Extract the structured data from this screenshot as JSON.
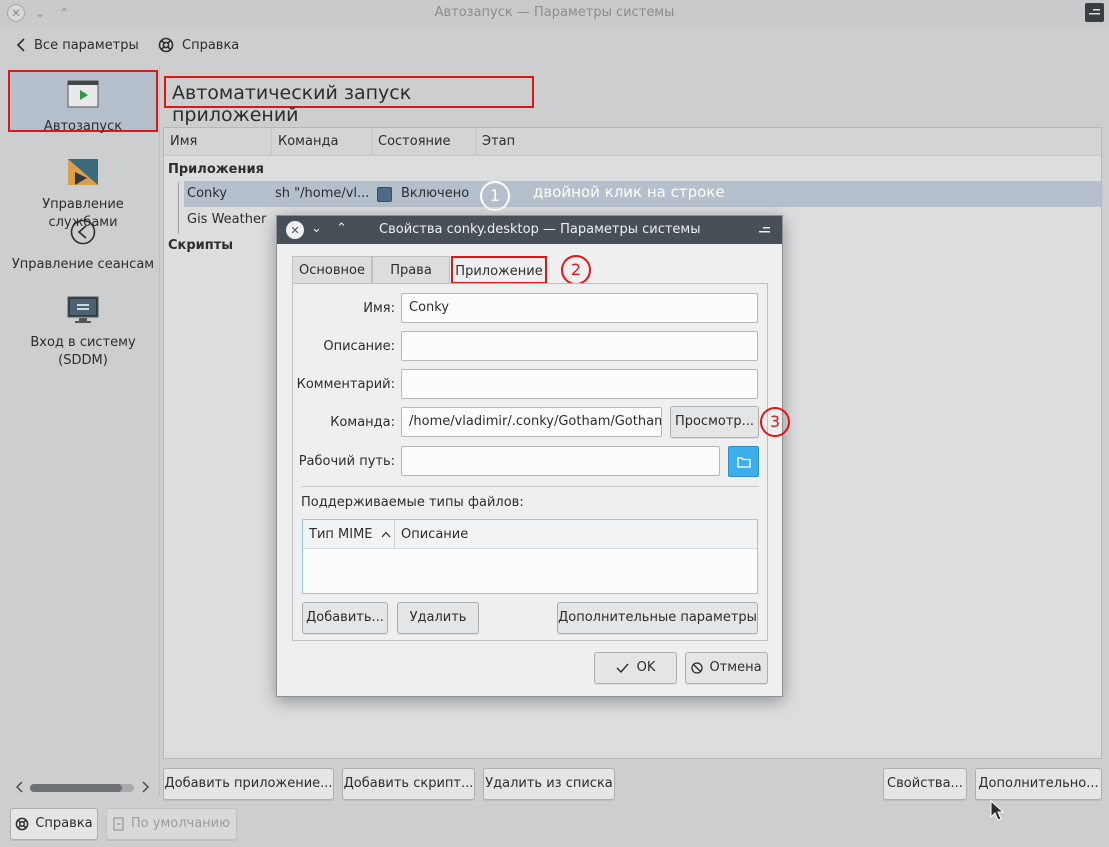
{
  "window": {
    "title": "Автозапуск — Параметры системы"
  },
  "toolbar": {
    "back_label": "Все параметры",
    "help_label": "Справка"
  },
  "sidebar": {
    "items": [
      {
        "label": "Автозапуск",
        "icon": "autostart-icon"
      },
      {
        "label": "Управление\nслужбами",
        "icon": "services-icon"
      },
      {
        "label": "Управление сеансам",
        "icon": "sessions-icon"
      },
      {
        "label": "Вход в систему\n(SDDM)",
        "icon": "sddm-icon"
      }
    ]
  },
  "page": {
    "title": "Автоматический запуск приложений"
  },
  "table": {
    "columns": [
      "Имя",
      "Команда",
      "Состояние",
      "Этап"
    ],
    "group_apps": "Приложения",
    "group_scripts": "Скрипты",
    "rows": [
      {
        "name": "Conky",
        "command": "sh \"/home/vl...",
        "state": "Включено"
      },
      {
        "name": "Gis Weather"
      }
    ]
  },
  "annotations": {
    "step1": "1",
    "step1_text": "двойной клик на строке",
    "step2": "2",
    "step3": "3"
  },
  "dialog": {
    "title": "Свойства conky.desktop — Параметры системы",
    "tabs": [
      "Основное",
      "Права",
      "Приложение"
    ],
    "labels": {
      "name": "Имя:",
      "description": "Описание:",
      "comment": "Комментарий:",
      "command": "Команда:",
      "workdir": "Рабочий путь:"
    },
    "values": {
      "name": "Conky",
      "description": "",
      "comment": "",
      "command": "/home/vladimir/.conky/Gotham/Gotham",
      "workdir": ""
    },
    "browse_label": "Просмотр...",
    "filetypes_label": "Поддерживаемые типы файлов:",
    "mime_columns": [
      "Тип MIME",
      "Описание"
    ],
    "add_label": "Добавить...",
    "remove_label": "Удалить",
    "advanced_label": "Дополнительные параметры",
    "ok_label": "OK",
    "cancel_label": "Отмена"
  },
  "bottom_buttons": {
    "add_app": "Добавить приложение...",
    "add_script": "Добавить скрипт...",
    "remove": "Удалить из списка",
    "properties": "Свойства...",
    "more": "Дополнительно..."
  },
  "footer": {
    "help_label": "Справка",
    "defaults_label": "По умолчанию"
  },
  "colors": {
    "highlight": "#e01616",
    "dialog_title": "#475057",
    "selected_row": "#b6c0cc",
    "folder_button": "#3daee9"
  }
}
